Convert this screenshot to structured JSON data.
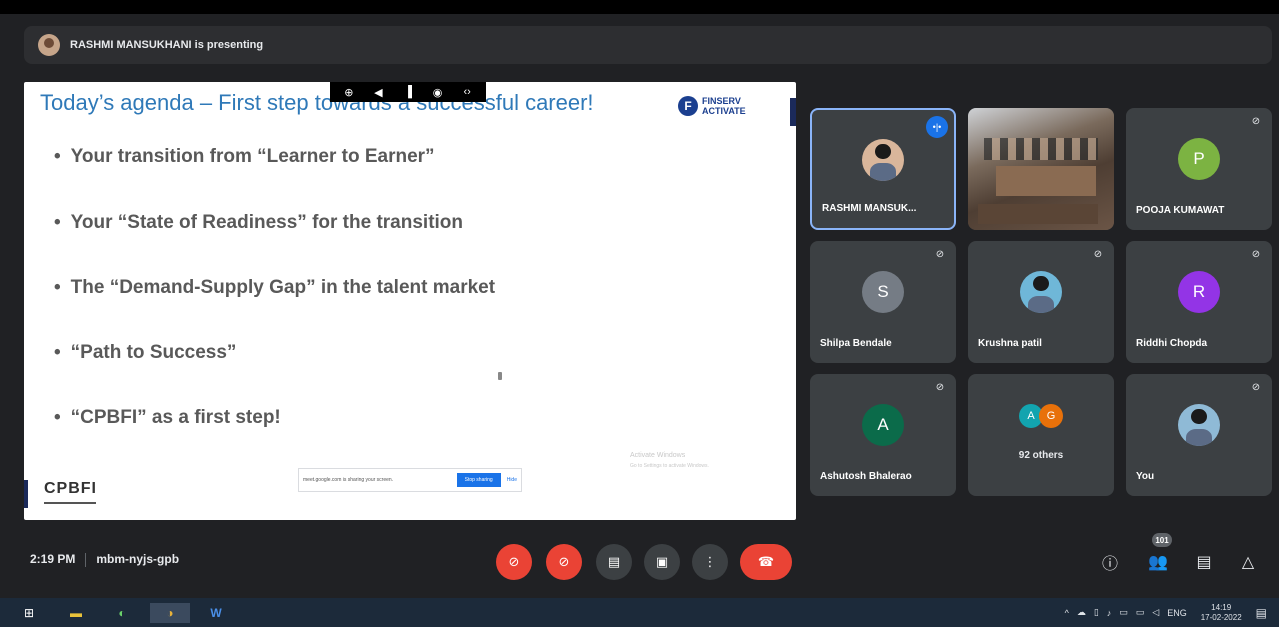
{
  "presenter_bar": {
    "text": "RASHMI MANSUKHANI is presenting"
  },
  "slide": {
    "title": "Today’s agenda – First step towards a successful career!",
    "toolbar": [
      "⊕",
      "◀",
      "▐",
      "◉",
      "‹›"
    ],
    "logo": {
      "mark": "F",
      "line1": "FINSERV",
      "line2": "ACTIVATE"
    },
    "bullets": [
      "Your transition from “Learner to Earner”",
      "Your “State of Readiness” for the transition",
      "The “Demand-Supply Gap” in the talent market",
      "“Path to Success”",
      "“CPBFI” as a first step!"
    ],
    "footer_logo": "CPBFI",
    "share_bar": {
      "text": "meet.google.com is sharing your screen.",
      "stop": "Stop sharing",
      "hide": "Hide"
    },
    "watermark": {
      "line1": "Activate Windows",
      "line2": "Go to Settings to activate Windows."
    }
  },
  "tiles": [
    {
      "name": "RASHMI MANSUK...",
      "type": "photo",
      "speaking": true,
      "speaking_icon": "•|•"
    },
    {
      "name": "",
      "type": "room"
    },
    {
      "name": "POOJA KUMAWAT",
      "type": "letter",
      "letter": "P",
      "color": "#7cb342",
      "mic_icon": "⊘"
    },
    {
      "name": "Shilpa Bendale",
      "type": "letter",
      "letter": "S",
      "color": "#757c85",
      "mic_icon": "⊘"
    },
    {
      "name": "Krushna patil",
      "type": "photo",
      "mic_icon": "⊘"
    },
    {
      "name": "Riddhi Chopda",
      "type": "letter",
      "letter": "R",
      "color": "#9334e6",
      "mic_icon": "⊘"
    },
    {
      "name": "Ashutosh Bhalerao",
      "type": "letter",
      "letter": "A",
      "color": "#0b6b4a",
      "mic_icon": "⊘"
    },
    {
      "name": "",
      "type": "others",
      "label": "92 others",
      "a1": "A",
      "a1_color": "#12a4af",
      "a2": "G",
      "a2_color": "#e8710a"
    },
    {
      "name": "You",
      "type": "photo",
      "mic_icon": "⊘"
    }
  ],
  "bottom": {
    "time": "2:19 PM",
    "code": "mbm-nyjs-gpb",
    "controls": {
      "mic": "⊘",
      "cam": "⊘",
      "captions": "▤",
      "present": "▣",
      "more": "⋮",
      "hangup": "☎"
    },
    "right": {
      "info": "ⓘ",
      "people": "👥",
      "people_count": "101",
      "chat": "▤",
      "activities": "△"
    }
  },
  "taskbar": {
    "apps": [
      "⊞",
      "▬",
      "◐",
      "◑",
      "W"
    ],
    "tray": [
      "^",
      "☁",
      "▯",
      "♪",
      "▭",
      "▭",
      "◁"
    ],
    "lang": "ENG",
    "time": "14:19",
    "date": "17-02-2022",
    "notif": "▤"
  }
}
